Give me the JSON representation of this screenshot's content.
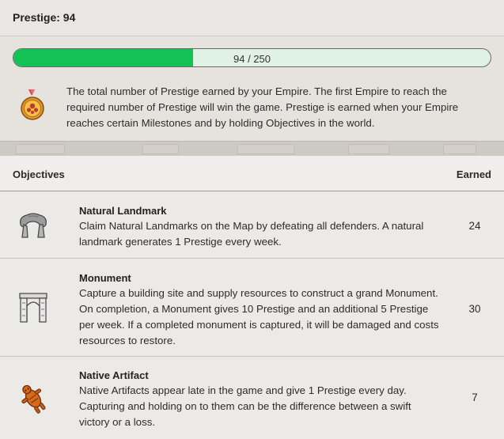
{
  "header": {
    "title": "Prestige: 94"
  },
  "progress": {
    "label": "94 / 250",
    "current": 94,
    "max": 250,
    "fill_color": "#13c154",
    "track_color": "#dff2e3"
  },
  "description": {
    "icon": "gold-medal-icon",
    "text": "The total number of Prestige earned by your Empire. The first Empire to reach the required number of Prestige will win the game. Prestige is earned when your Empire reaches certain Milestones and by holding Objectives in the world."
  },
  "table": {
    "columns": [
      "Objectives",
      "Earned"
    ],
    "rows": [
      {
        "icon": "natural-landmark-icon",
        "title": "Natural Landmark",
        "description": "Claim Natural Landmarks on the Map by defeating all defenders. A natural landmark generates 1 Prestige every week.",
        "earned": "24"
      },
      {
        "icon": "monument-icon",
        "title": "Monument",
        "description": "Capture a building site and supply resources to construct a grand Monument. On completion, a Monument gives 10 Prestige and an additional 5 Prestige per week. If a completed monument is captured, it will be damaged and costs resources to restore.",
        "earned": "30"
      },
      {
        "icon": "native-artifact-icon",
        "title": "Native Artifact",
        "description": "Native Artifacts appear late in the game and give 1 Prestige every day. Capturing and holding on to them can be the difference between a swift victory or a loss.",
        "earned": "7"
      }
    ]
  }
}
